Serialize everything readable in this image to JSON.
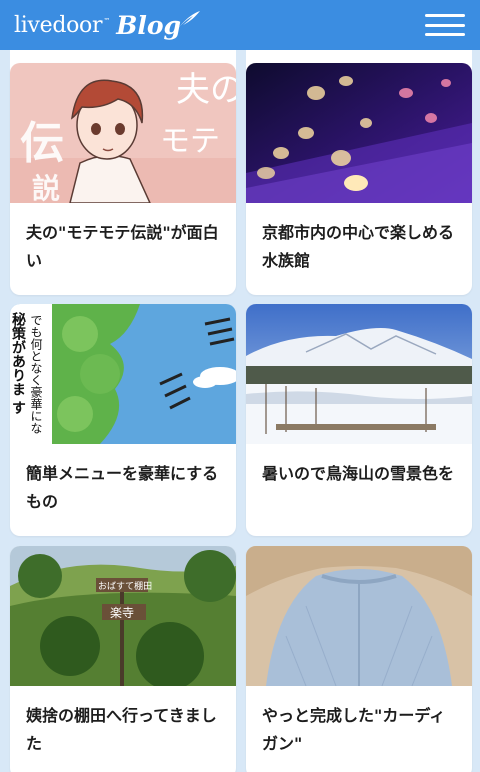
{
  "header": {
    "brand": "livedoor",
    "tm": "™",
    "blog": "Blog",
    "colors": {
      "bar": "#3b8de1",
      "background": "#d8e8f7"
    }
  },
  "cards": [
    {
      "title": "夫の\"モテモテ伝説\"が面白い",
      "image": "manga-illustration"
    },
    {
      "title": "京都市内の中心で楽しめる水族館",
      "image": "jellyfish-aquarium"
    },
    {
      "title": "簡単メニューを豪華にするもの",
      "image": "comic-panel-sky"
    },
    {
      "title": "暑いので鳥海山の雪景色を",
      "image": "snowy-mountain"
    },
    {
      "title": "姨捨の棚田へ行ってきました",
      "image": "rice-terrace-sign"
    },
    {
      "title": "やっと完成した\"カーディガン\"",
      "image": "knit-cardigan"
    }
  ],
  "images": {
    "manga_text": [
      "夫の",
      "モテ",
      "伝",
      "説"
    ],
    "comic_vertical_1": "でも何となく豪華にな",
    "comic_vertical_2": "秘策がありま す",
    "sign_text": [
      "おばすて棚田",
      "楽寺"
    ]
  }
}
